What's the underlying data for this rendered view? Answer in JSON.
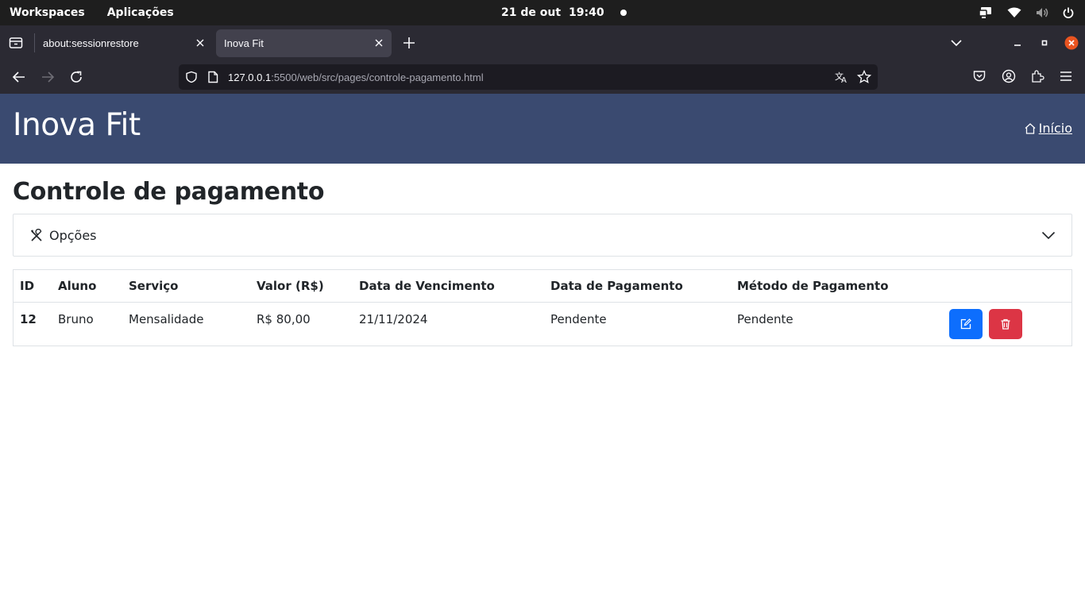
{
  "system_bar": {
    "workspaces": "Workspaces",
    "applications": "Aplicações",
    "date": "21 de out",
    "time": "19:40"
  },
  "browser": {
    "tabs": [
      {
        "title": "about:sessionrestore",
        "active": false
      },
      {
        "title": "Inova Fit",
        "active": true
      }
    ],
    "url_host": "127.0.0.1",
    "url_path": ":5500/web/src/pages/controle-pagamento.html"
  },
  "site": {
    "brand": "Inova Fit",
    "home_link": "Início",
    "header_color": "#3a4a70"
  },
  "page": {
    "title": "Controle de pagamento",
    "options_label": "Opções"
  },
  "table": {
    "headers": [
      "ID",
      "Aluno",
      "Serviço",
      "Valor (R$)",
      "Data de Vencimento",
      "Data de Pagamento",
      "Método de Pagamento",
      ""
    ],
    "rows": [
      {
        "id": "12",
        "aluno": "Bruno",
        "servico": "Mensalidade",
        "valor": "R$ 80,00",
        "vencimento": "21/11/2024",
        "pagamento": "Pendente",
        "metodo": "Pendente"
      }
    ]
  },
  "colors": {
    "edit_button": "#0d6efd",
    "delete_button": "#dc3545"
  }
}
